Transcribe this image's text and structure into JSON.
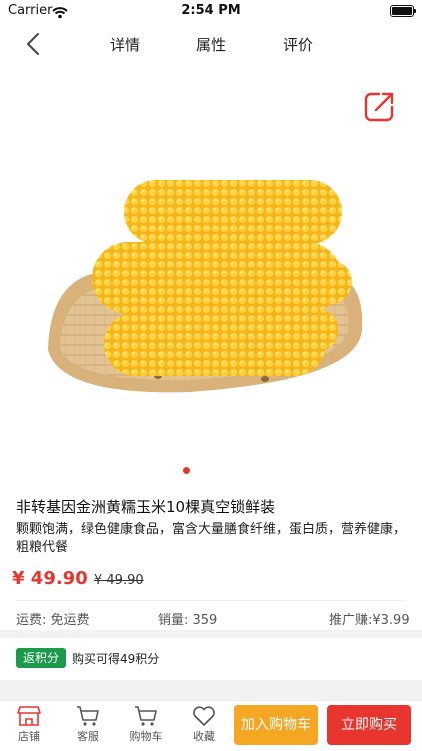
{
  "status": {
    "carrier": "Carrier",
    "time": "2:54 PM"
  },
  "nav": {
    "tabs": [
      "详情",
      "属性",
      "评价"
    ]
  },
  "product": {
    "title": "非转基因金洲黄糯玉米10棵真空锁鲜装",
    "description": "颗颗饱满，绿色健康食品，富含大量膳食纤维，蛋白质，营养健康，粗粮代餐",
    "price": "¥ 49.90",
    "original_price": "¥ 49.90"
  },
  "meta": {
    "shipping": "运费: 免运费",
    "sales": "销量: 359",
    "commission": "推广赚:¥3.99"
  },
  "points": {
    "badge": "返积分",
    "text": "购买可得49积分"
  },
  "bottom": {
    "shop": "店铺",
    "service": "客服",
    "cart": "购物车",
    "favorite": "收藏",
    "add_to_cart": "加入购物车",
    "buy_now": "立即购买"
  },
  "colors": {
    "accent": "#e8352e",
    "cart_button": "#f5a623",
    "points_badge": "#1a9a4a"
  },
  "icons": [
    "wifi-icon",
    "battery-icon",
    "back-arrow-icon",
    "share-icon",
    "shop-icon",
    "customer-service-icon",
    "cart-icon",
    "heart-icon"
  ]
}
